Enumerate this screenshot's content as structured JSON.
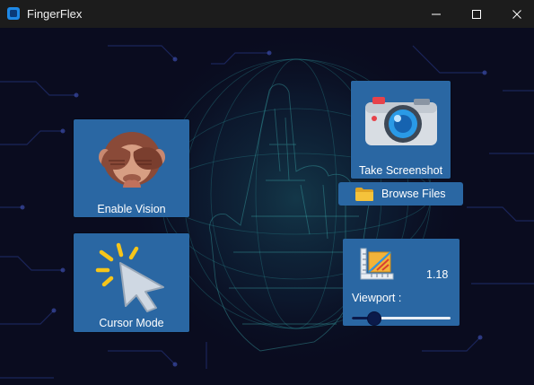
{
  "window": {
    "title": "FingerFlex",
    "controls": [
      "minimize-icon",
      "maximize-icon",
      "close-icon"
    ]
  },
  "tiles": {
    "vision": {
      "label": "Enable Vision",
      "icon": "see-no-evil-monkey-icon"
    },
    "cursor": {
      "label": "Cursor Mode",
      "icon": "cursor-click-icon"
    },
    "screenshot": {
      "label": "Take Screenshot",
      "icon": "camera-icon"
    }
  },
  "browse": {
    "label": "Browse Files",
    "icon": "folder-icon"
  },
  "viewport": {
    "label": "Viewport :",
    "value": "1.18",
    "icon": "ruler-grid-icon",
    "slider_fraction": 0.22
  },
  "colors": {
    "tile": "#2a67a3",
    "background": "#0a0c1f",
    "titlebar": "#1c1c1c",
    "slider_thumb": "#0b1a4a"
  }
}
